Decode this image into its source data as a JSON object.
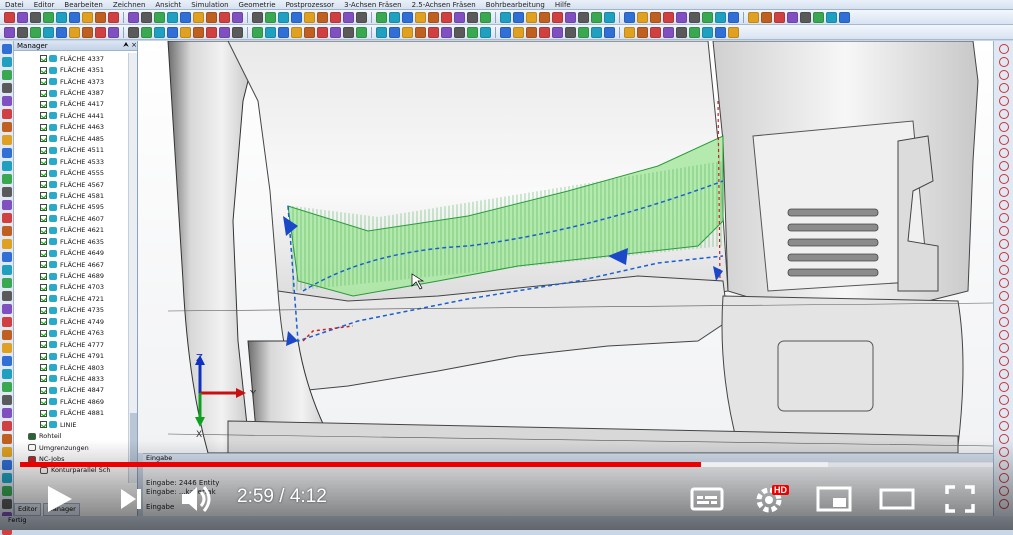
{
  "menu": [
    "Datei",
    "Editor",
    "Bearbeiten",
    "Zeichnen",
    "Ansicht",
    "Simulation",
    "Geometrie",
    "Postprozessor",
    "3-Achsen Fräsen",
    "2.5-Achsen Fräsen",
    "Bohrbearbeitung",
    "Hilfe"
  ],
  "manager": {
    "title": "Manager",
    "pin": "⮝ ×",
    "items": [
      "FLÄCHE 4337",
      "FLÄCHE 4351",
      "FLÄCHE 4373",
      "FLÄCHE 4387",
      "FLÄCHE 4417",
      "FLÄCHE 4441",
      "FLÄCHE 4463",
      "FLÄCHE 4485",
      "FLÄCHE 4511",
      "FLÄCHE 4533",
      "FLÄCHE 4555",
      "FLÄCHE 4567",
      "FLÄCHE 4581",
      "FLÄCHE 4595",
      "FLÄCHE 4607",
      "FLÄCHE 4621",
      "FLÄCHE 4635",
      "FLÄCHE 4649",
      "FLÄCHE 4667",
      "FLÄCHE 4689",
      "FLÄCHE 4703",
      "FLÄCHE 4721",
      "FLÄCHE 4735",
      "FLÄCHE 4749",
      "FLÄCHE 4763",
      "FLÄCHE 4777",
      "FLÄCHE 4791",
      "FLÄCHE 4803",
      "FLÄCHE 4833",
      "FLÄCHE 4847",
      "FLÄCHE 4869",
      "FLÄCHE 4881",
      "LINIE"
    ],
    "rohteil": "Rohteil",
    "umgrenzungen": "Umgrenzungen",
    "nc_jobs": "NC-Jobs",
    "kontur": "Konturparallel Sch"
  },
  "tabs": {
    "editor": "Editor",
    "manager": "Manager"
  },
  "eingabe": {
    "header": "Eingabe",
    "lines": [
      "Eingabe: 2446 Entity",
      "Eingabe: ...kalierfak",
      "Eingabe"
    ]
  },
  "status": "Fertig",
  "video": {
    "current_time": "2:59",
    "duration": "4:12",
    "progress": 0.7,
    "buffered": 0.83,
    "hd_badge": "HD",
    "accent": "#ee0000"
  },
  "axes": {
    "z": "Z",
    "y": "Y",
    "x": "X"
  }
}
